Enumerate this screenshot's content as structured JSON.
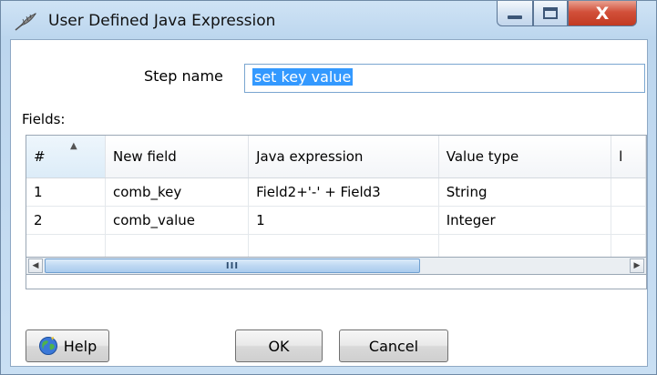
{
  "window": {
    "title": "User Defined Java Expression",
    "close_glyph": "X"
  },
  "form": {
    "step_name_label": "Step name",
    "step_name_value": "set key value",
    "fields_label": "Fields:"
  },
  "table": {
    "headers": [
      "#",
      "New field",
      "Java expression",
      "Value type",
      "l"
    ],
    "rows": [
      [
        "1",
        "comb_key",
        "Field2+'-' + Field3",
        "String",
        ""
      ],
      [
        "2",
        "comb_value",
        "1",
        "Integer",
        ""
      ]
    ],
    "scroll_grip": "III"
  },
  "buttons": {
    "help": "Help",
    "ok": "OK",
    "cancel": "Cancel"
  },
  "icons": {
    "title": "feather-quill-icon",
    "help": "globe-help-icon"
  },
  "colors": {
    "selection": "#3399ff",
    "close_button": "#c23a22",
    "window_frame": "#c9dff3"
  }
}
